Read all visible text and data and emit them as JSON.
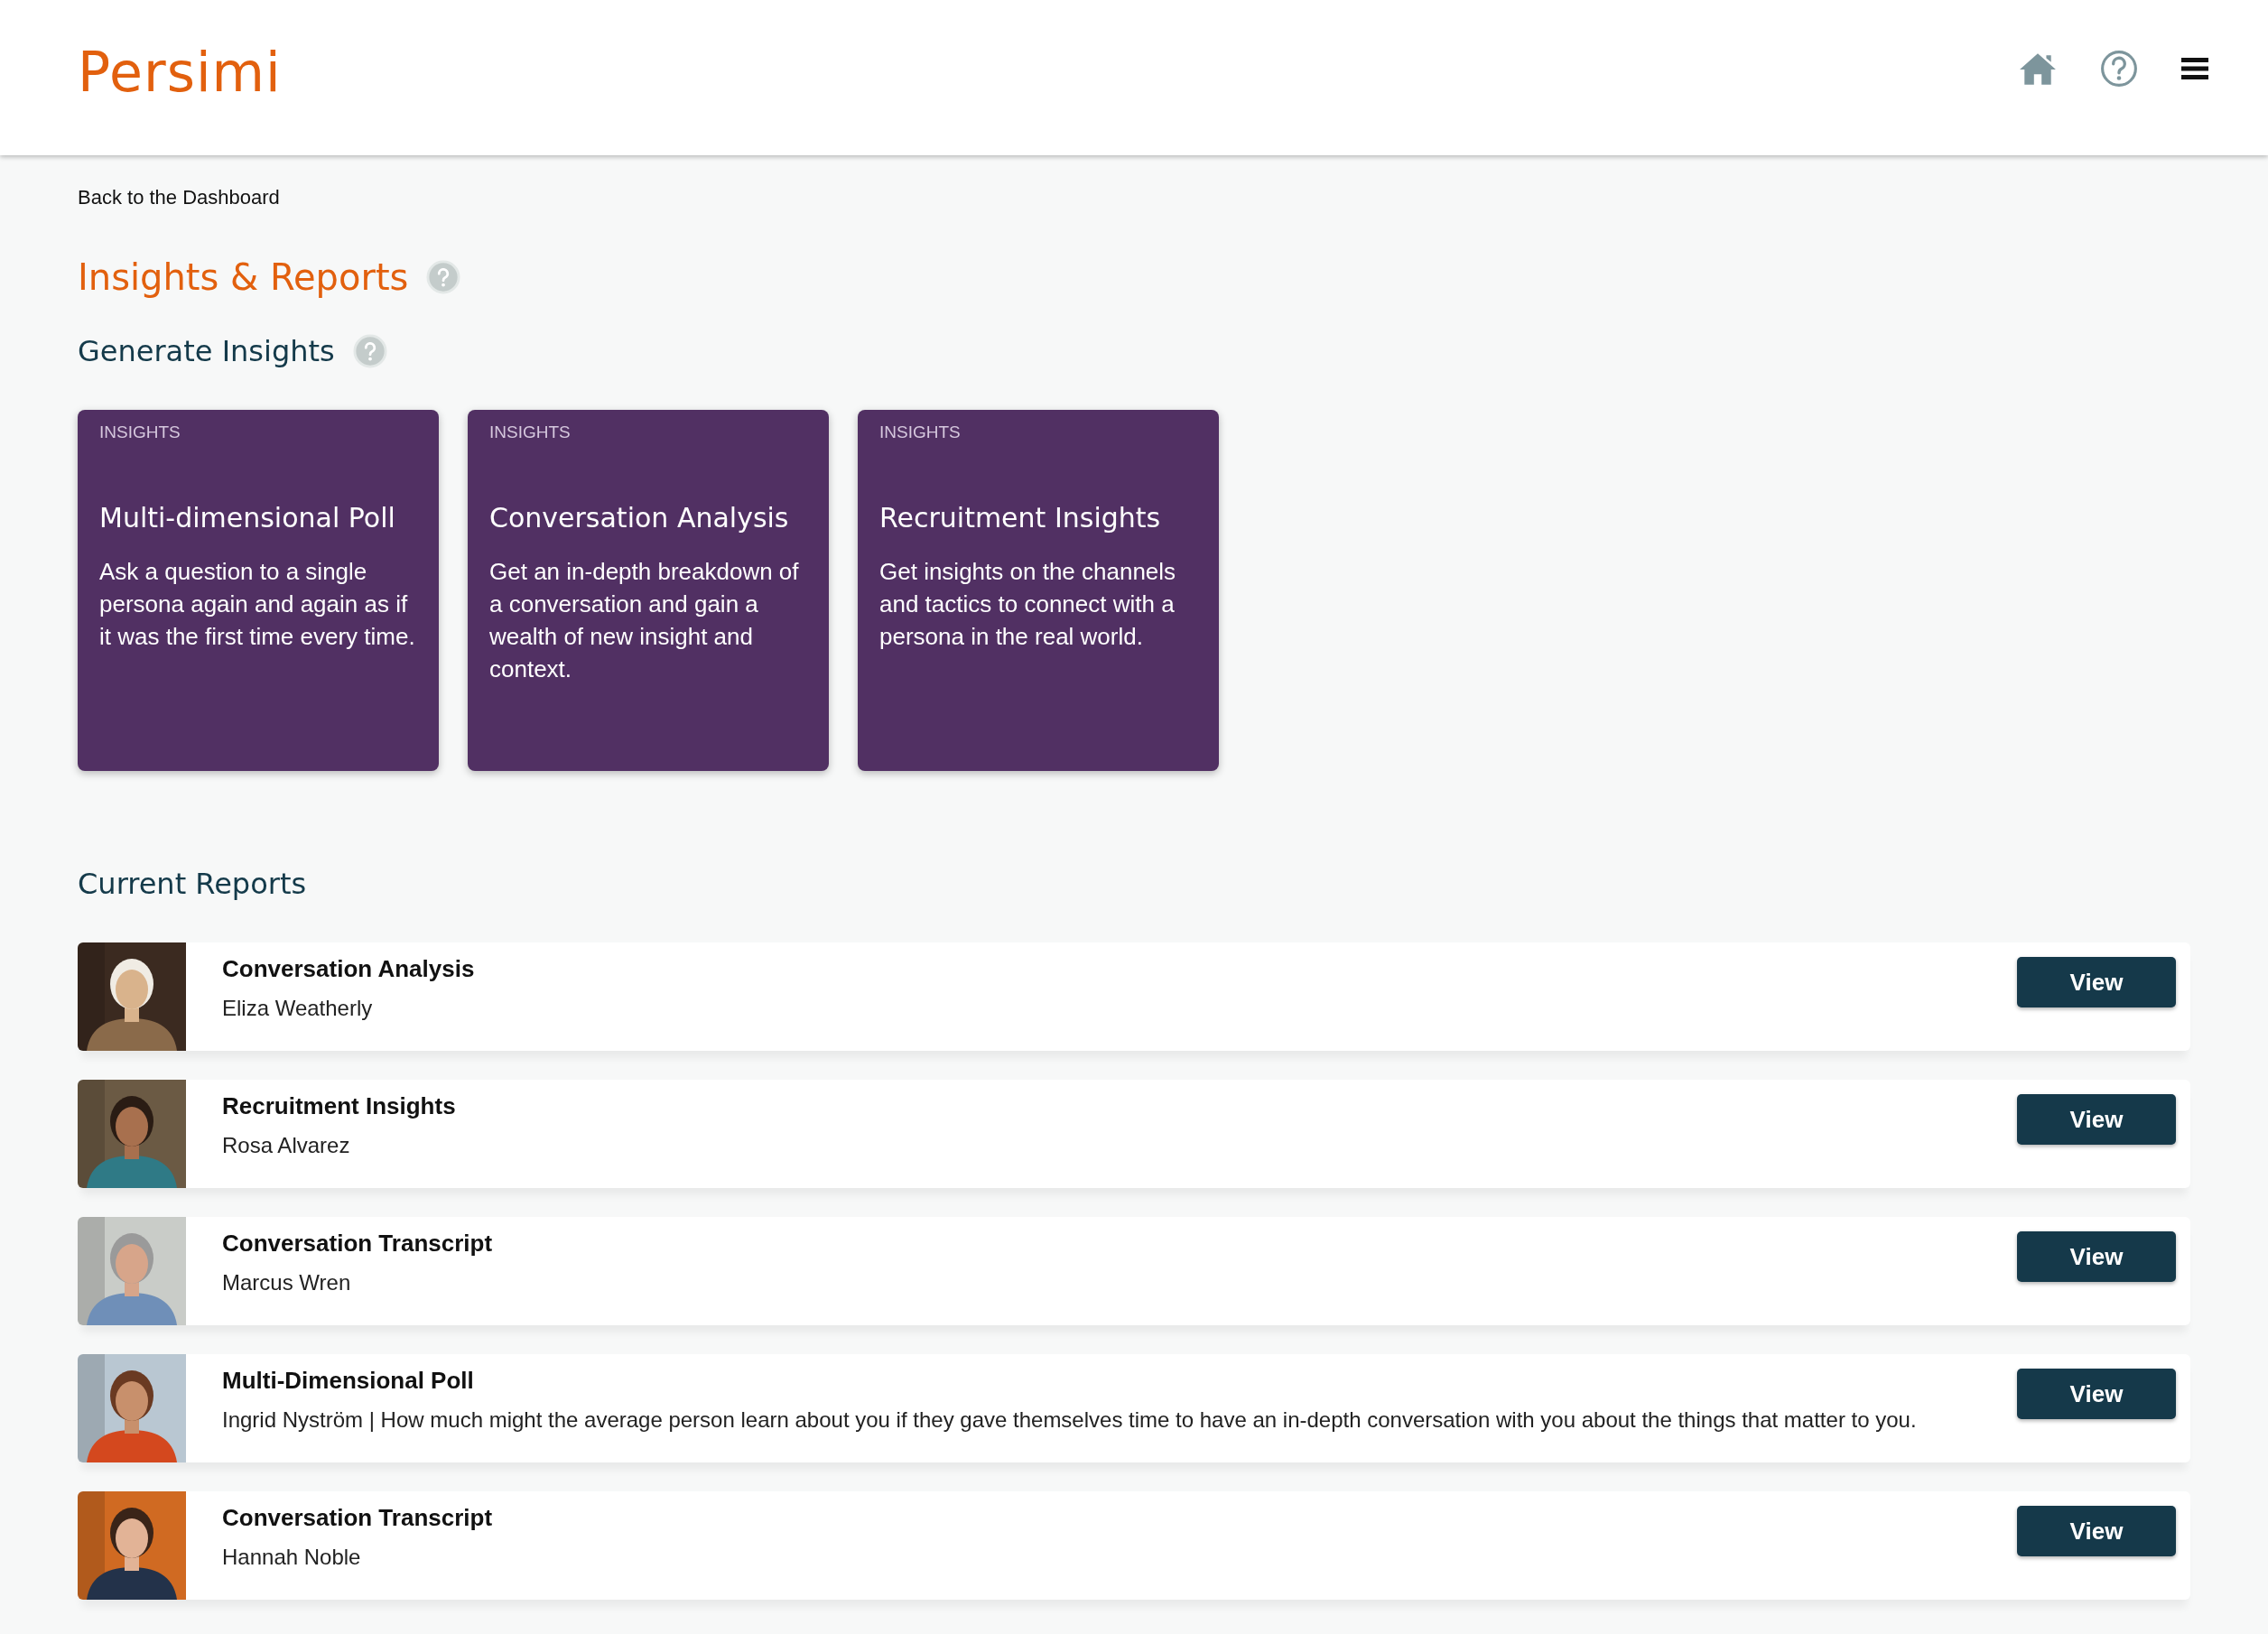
{
  "header": {
    "logo": "Persimi"
  },
  "back_link": "Back to the Dashboard",
  "page_title": "Insights & Reports",
  "generate_section": {
    "title": "Generate Insights",
    "cards": [
      {
        "tag": "INSIGHTS",
        "title": "Multi-dimensional Poll",
        "description": "Ask a question to a single persona again and again as if it was the first time every time."
      },
      {
        "tag": "INSIGHTS",
        "title": "Conversation Analysis",
        "description": "Get an in-depth breakdown of a conversation and gain a wealth of new insight and context."
      },
      {
        "tag": "INSIGHTS",
        "title": "Recruitment Insights",
        "description": "Get insights on the channels and tactics to connect with a persona in the real world."
      }
    ]
  },
  "current_reports": {
    "title": "Current Reports",
    "rows": [
      {
        "title": "Conversation Analysis",
        "subtitle": "Eliza Weatherly",
        "button": "View"
      },
      {
        "title": "Recruitment Insights",
        "subtitle": "Rosa Alvarez",
        "button": "View"
      },
      {
        "title": "Conversation Transcript",
        "subtitle": "Marcus Wren",
        "button": "View"
      },
      {
        "title": "Multi-Dimensional Poll",
        "subtitle": "Ingrid Nyström | How much might the average person learn about you if they gave themselves time to have an in-depth conversation with you about the things that matter to you.",
        "button": "View"
      },
      {
        "title": "Conversation Transcript",
        "subtitle": "Hannah Noble",
        "button": "View"
      }
    ]
  }
}
